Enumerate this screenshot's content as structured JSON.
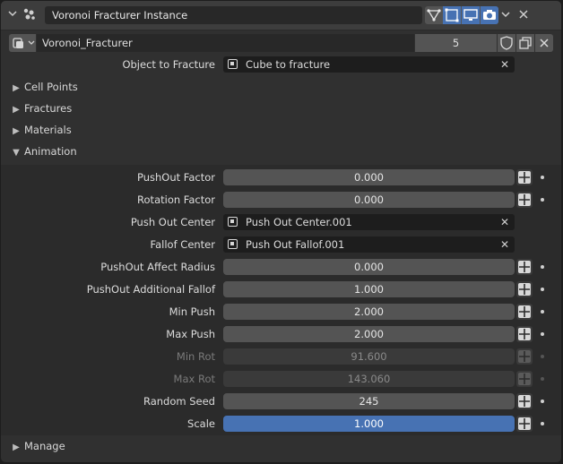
{
  "header": {
    "title": "Voronoi Fracturer Instance",
    "icons": [
      "collapse-chevron-icon",
      "modifier-type-icon",
      "edit-mode-icon",
      "editmode-cage-icon",
      "viewport-display-icon",
      "render-icon",
      "dropdown-chevron-icon",
      "close-icon"
    ]
  },
  "datablock": {
    "name": "Voronoi_Fracturer",
    "users": "5"
  },
  "object_to_fracture": {
    "label": "Object to Fracture",
    "value": "Cube to fracture"
  },
  "sections": {
    "cell_points": "Cell Points",
    "fractures": "Fractures",
    "materials": "Materials",
    "animation": "Animation",
    "manage": "Manage"
  },
  "animation": {
    "pushout_factor": {
      "label": "PushOut Factor",
      "value": "0.000"
    },
    "rotation_factor": {
      "label": "Rotation Factor",
      "value": "0.000"
    },
    "push_out_center": {
      "label": "Push Out Center",
      "value": "Push Out Center.001"
    },
    "fallof_center": {
      "label": "Fallof Center",
      "value": "Push Out Fallof.001"
    },
    "pushout_affect_radius": {
      "label": "PushOut Affect Radius",
      "value": "0.000"
    },
    "pushout_additional_fallof": {
      "label": "PushOut Additional Fallof",
      "value": "1.000"
    },
    "min_push": {
      "label": "Min Push",
      "value": "2.000"
    },
    "max_push": {
      "label": "Max Push",
      "value": "2.000"
    },
    "min_rot": {
      "label": "Min Rot",
      "value": "91.600"
    },
    "max_rot": {
      "label": "Max Rot",
      "value": "143.060"
    },
    "random_seed": {
      "label": "Random Seed",
      "value": "245"
    },
    "scale": {
      "label": "Scale",
      "value": "1.000"
    }
  }
}
